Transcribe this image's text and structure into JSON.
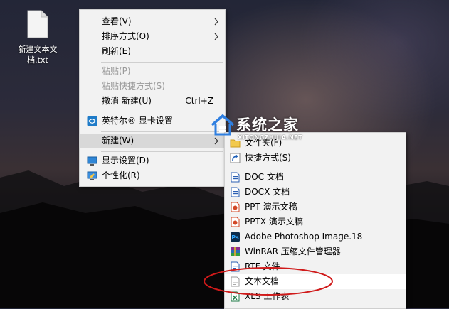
{
  "desktop": {
    "file_label": "新建文本文档.txt"
  },
  "context_menu": {
    "items": [
      {
        "label": "查看(V)",
        "has_submenu": true
      },
      {
        "label": "排序方式(O)",
        "has_submenu": true
      },
      {
        "label": "刷新(E)"
      },
      {
        "label": "粘贴(P)",
        "disabled": true
      },
      {
        "label": "粘贴快捷方式(S)",
        "disabled": true
      },
      {
        "label": "撤消 新建(U)",
        "shortcut": "Ctrl+Z"
      },
      {
        "label": "英特尔® 显卡设置",
        "icon": "intel-graphics-icon"
      },
      {
        "label": "新建(W)",
        "has_submenu": true,
        "highlighted": true
      },
      {
        "label": "显示设置(D)",
        "icon": "display-settings-icon"
      },
      {
        "label": "个性化(R)",
        "icon": "personalize-icon"
      }
    ]
  },
  "new_submenu": {
    "items": [
      {
        "label": "文件夹(F)",
        "icon": "folder-icon"
      },
      {
        "label": "快捷方式(S)",
        "icon": "shortcut-icon"
      },
      {
        "label": "DOC 文档",
        "icon": "doc-icon"
      },
      {
        "label": "DOCX 文档",
        "icon": "docx-icon"
      },
      {
        "label": "PPT 演示文稿",
        "icon": "ppt-icon"
      },
      {
        "label": "PPTX 演示文稿",
        "icon": "pptx-icon"
      },
      {
        "label": "Adobe Photoshop Image.18",
        "icon": "photoshop-icon"
      },
      {
        "label": "WinRAR 压缩文件管理器",
        "icon": "winrar-icon"
      },
      {
        "label": "RTF 文件",
        "icon": "rtf-icon"
      },
      {
        "label": "文本文档",
        "icon": "text-document-icon",
        "highlighted": true
      },
      {
        "label": "XLS 工作表",
        "icon": "xls-icon"
      }
    ]
  },
  "watermark": {
    "brand": "系统之家",
    "url": "XITONGZHIJIA.NET"
  },
  "colors": {
    "menu_bg": "#f2f2f2",
    "highlight": "#d8d8d8",
    "annotation": "#d01a1a"
  }
}
